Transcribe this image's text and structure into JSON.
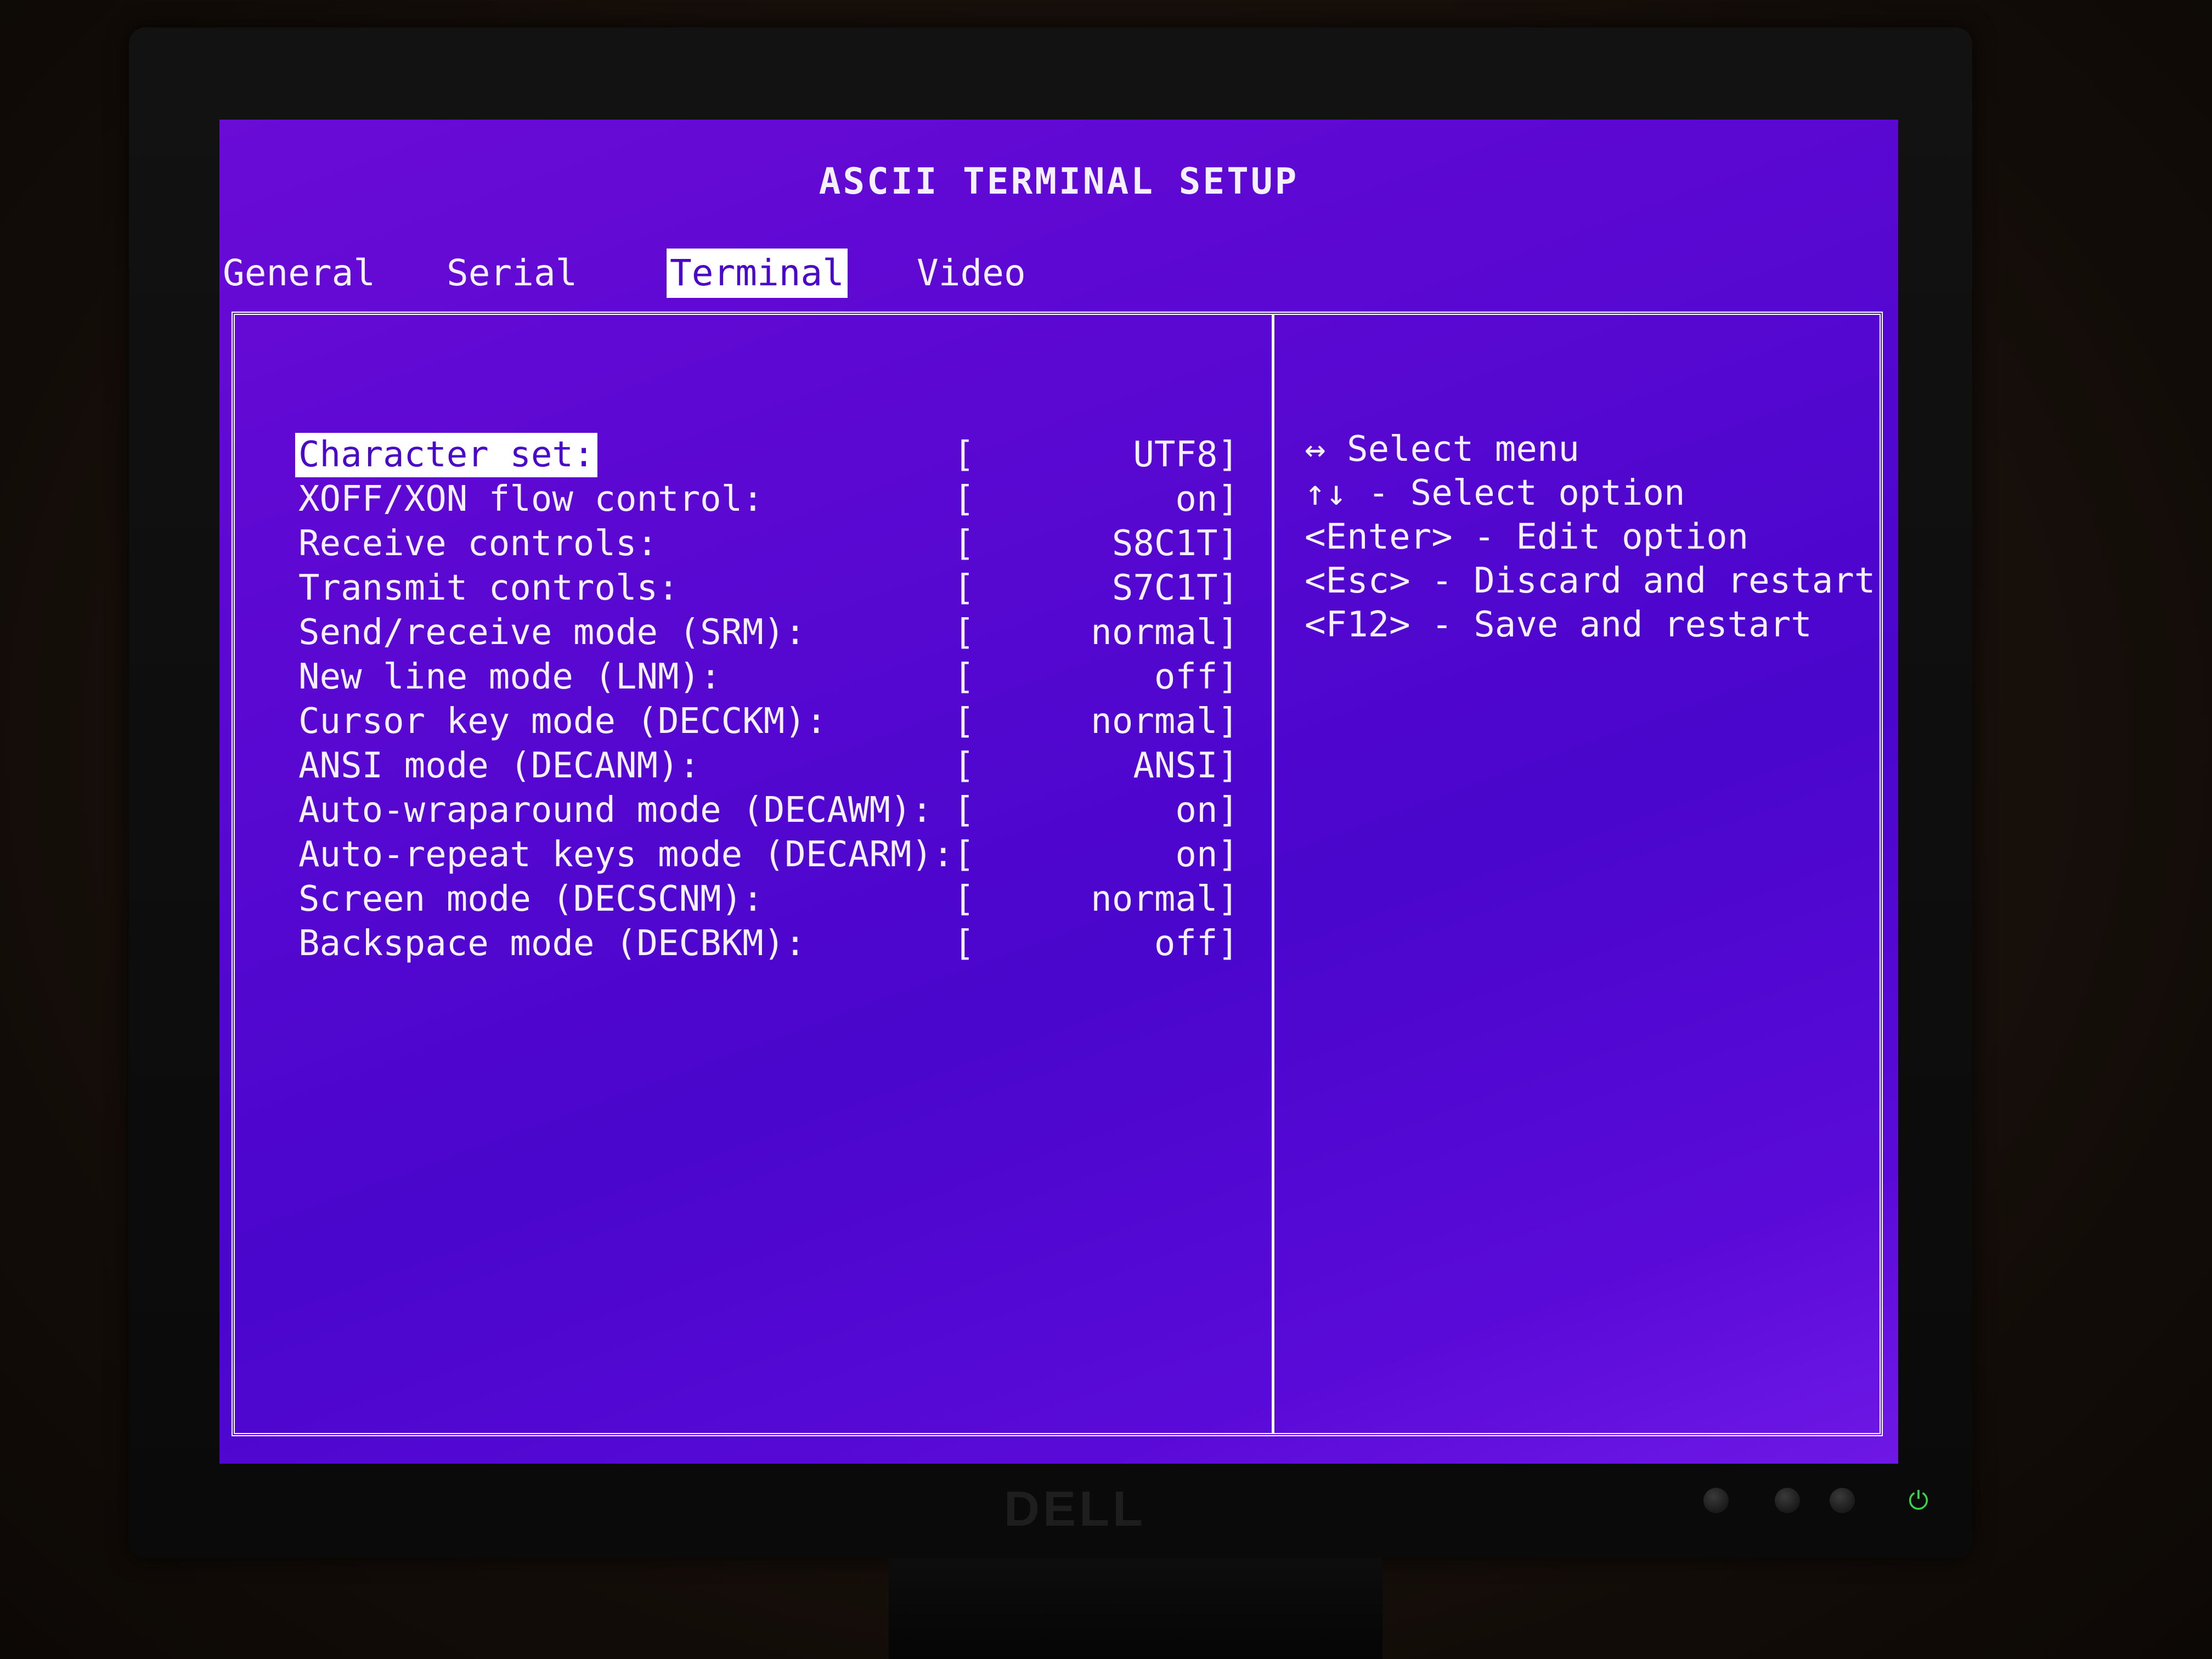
{
  "setup": {
    "title": "ASCII TERMINAL SETUP",
    "tabs": [
      {
        "label": "General",
        "active": false
      },
      {
        "label": "Serial",
        "active": false
      },
      {
        "label": "Terminal",
        "active": true
      },
      {
        "label": "Video",
        "active": false
      }
    ],
    "options": [
      {
        "label": "Character set:",
        "value": "UTF8]",
        "selected": true
      },
      {
        "label": "XOFF/XON flow control:",
        "value": "on]"
      },
      {
        "label": "Receive controls:",
        "value": "S8C1T]"
      },
      {
        "label": "Transmit controls:",
        "value": "S7C1T]"
      },
      {
        "label": "Send/receive mode (SRM):",
        "value": "normal]"
      },
      {
        "label": "New line mode (LNM):",
        "value": "off]"
      },
      {
        "label": "Cursor key mode (DECCKM):",
        "value": "normal]"
      },
      {
        "label": "ANSI mode (DECANM):",
        "value": "ANSI]"
      },
      {
        "label": "Auto-wraparound mode (DECAWM):",
        "value": "on]"
      },
      {
        "label": "Auto-repeat keys mode (DECARM):",
        "value": "on]"
      },
      {
        "label": "Screen mode (DECSCNM):",
        "value": "normal]"
      },
      {
        "label": "Backspace mode (DECBKM):",
        "value": "off]"
      }
    ],
    "bracket_open": "[",
    "help": [
      "↔ Select menu",
      "↑↓ - Select option",
      "<Enter> - Edit option",
      "<Esc> - Discard and restart",
      "<F12> - Save and restart"
    ]
  },
  "monitor": {
    "brand": "DELL",
    "power_icon": "power-icon",
    "power_led_color": "#3ad64a"
  },
  "colors": {
    "background": "#5a08d2",
    "text": "#f4f0ff",
    "highlight_bg": "#ffffff",
    "highlight_text": "#4a08c8"
  }
}
